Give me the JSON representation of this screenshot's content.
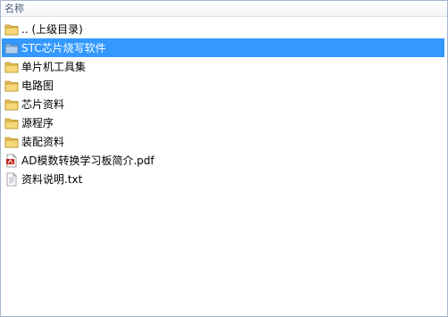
{
  "header": {
    "name_column": "名称"
  },
  "items": [
    {
      "label": ".. (上级目录)",
      "type": "folder",
      "selected": false
    },
    {
      "label": "STC芯片烧写软件",
      "type": "folder",
      "selected": true
    },
    {
      "label": "单片机工具集",
      "type": "folder",
      "selected": false
    },
    {
      "label": "电路图",
      "type": "folder",
      "selected": false
    },
    {
      "label": "芯片资料",
      "type": "folder",
      "selected": false
    },
    {
      "label": "源程序",
      "type": "folder",
      "selected": false
    },
    {
      "label": "装配资料",
      "type": "folder",
      "selected": false
    },
    {
      "label": "AD模数转换学习板简介.pdf",
      "type": "pdf",
      "selected": false
    },
    {
      "label": "资料说明.txt",
      "type": "txt",
      "selected": false
    }
  ],
  "colors": {
    "selection": "#3399ff",
    "folder": "#e8c15a",
    "pdf": "#c8231c"
  }
}
